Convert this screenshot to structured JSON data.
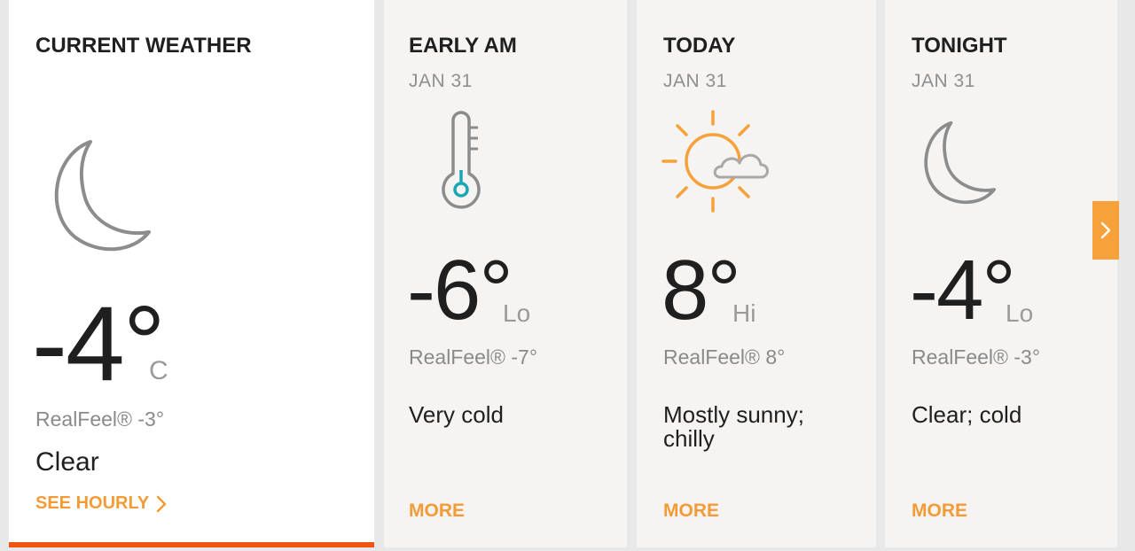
{
  "current": {
    "label": "CURRENT WEATHER",
    "icon": "moon-icon",
    "temp": "-4°",
    "unit": "C",
    "realfeel": "RealFeel® -3°",
    "phrase": "Clear",
    "see_hourly": "SEE HOURLY"
  },
  "forecasts": [
    {
      "label": "EARLY AM",
      "date": "JAN 31",
      "icon": "thermometer-icon",
      "temp": "-6°",
      "hilo": "Lo",
      "realfeel": "RealFeel® -7°",
      "phrase": "Very cold",
      "more": "MORE"
    },
    {
      "label": "TODAY",
      "date": "JAN 31",
      "icon": "sun-cloud-icon",
      "temp": "8°",
      "hilo": "Hi",
      "realfeel": "RealFeel® 8°",
      "phrase": "Mostly sunny; chilly",
      "more": "MORE"
    },
    {
      "label": "TONIGHT",
      "date": "JAN 31",
      "icon": "moon-icon",
      "temp": "-4°",
      "hilo": "Lo",
      "realfeel": "RealFeel® -3°",
      "phrase": "Clear; cold",
      "more": "MORE"
    }
  ],
  "colors": {
    "accent": "#f39c37",
    "active_bar": "#f05514",
    "thermo_accent": "#1aa7b5",
    "sun": "#f7a13a"
  },
  "next_button": {
    "icon": "chevron-right-icon"
  }
}
